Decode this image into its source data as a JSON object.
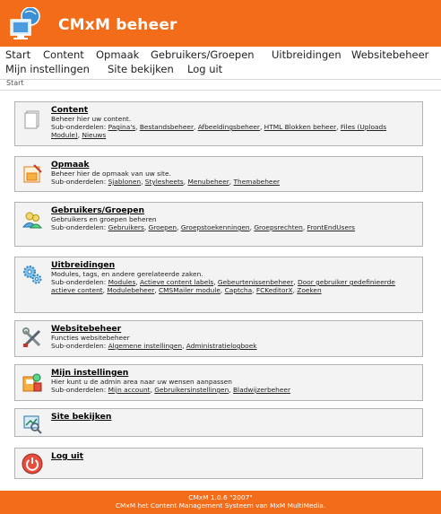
{
  "header": {
    "title": "CMxM beheer"
  },
  "menu": {
    "items": [
      "Start",
      "Content",
      "Opmaak",
      "Gebruikers/Groepen",
      "Uitbreidingen",
      "Websitebeheer",
      "Mijn instellingen",
      "Site bekijken",
      "Log uit"
    ]
  },
  "breadcrumb": "Start",
  "sections": [
    {
      "title": "Content",
      "icon": "document-icon",
      "description": "Beheer hier uw content.",
      "sub_label": "Sub-onderdelen:",
      "links": [
        "Pagina's",
        "Bestandsbeheer",
        "Afbeeldingsbeheer",
        "HTML Blokken beheer",
        "Files (Uploads Module)",
        "Nieuws"
      ]
    },
    {
      "title": "Opmaak",
      "icon": "layout-icon",
      "description": "Beheer hier de opmaak van uw site.",
      "sub_label": "Sub-onderdelen:",
      "links": [
        "Sjablonen",
        "Stylesheets",
        "Menubeheer",
        "Themabeheer"
      ]
    },
    {
      "title": "Gebruikers/Groepen",
      "icon": "users-icon",
      "description": "Gebruikers en groepen beheren",
      "sub_label": "Sub-onderdelen:",
      "links": [
        "Gebruikers",
        "Groepen",
        "Groepstoekenningen",
        "Groepsrechten",
        "FrontEndUsers"
      ]
    },
    {
      "title": "Uitbreidingen",
      "icon": "gears-icon",
      "description": "Modules, tags, en andere gerelateerde zaken.",
      "sub_label": "Sub-onderdelen:",
      "links": [
        "Modules",
        "Actieve content labels",
        "Gebeurtenissenbeheer",
        "Door gebruiker gedefinieerde actieve content",
        "Modulebeheer",
        "CMSMailer module",
        "Captcha",
        "FCKeditorX",
        "Zoeken"
      ]
    },
    {
      "title": "Websitebeheer",
      "icon": "tools-icon",
      "description": "Functies websitebeheer",
      "sub_label": "Sub-onderdelen:",
      "links": [
        "Algemene instellingen",
        "Administratielogboek"
      ]
    },
    {
      "title": "Mijn instellingen",
      "icon": "user-settings-icon",
      "description": "Hier kunt u de admin area naar uw wensen aanpassen",
      "sub_label": "Sub-onderdelen:",
      "links": [
        "Mijn account",
        "Gebruikersinstellingen",
        "Bladwijzerbeheer"
      ]
    },
    {
      "title": "Site bekijken",
      "icon": "view-site-icon"
    },
    {
      "title": "Log uit",
      "icon": "power-icon"
    }
  ],
  "footer": {
    "line1": "CMxM 1.0.6 \"2007\"",
    "line2": "CMxM het Content Management Systeem van MxM MultiMedia."
  },
  "colors": {
    "brand": "#f26c1a",
    "panel_bg": "#f3f3f3",
    "panel_border": "#b3b3b3"
  }
}
